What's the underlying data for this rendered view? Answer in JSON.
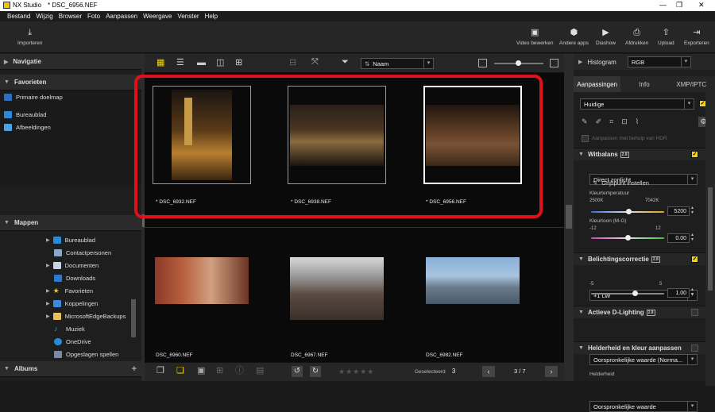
{
  "window": {
    "app_name": "NX Studio",
    "document": "* DSC_6956.NEF"
  },
  "menu": [
    "Bestand",
    "Wijzig",
    "Browser",
    "Foto",
    "Aanpassen",
    "Weergave",
    "Venster",
    "Help"
  ],
  "toolbar": {
    "import": "Importeren",
    "right_buttons": [
      "Video bewerken",
      "Andere apps",
      "Diashow",
      "Afdrukken",
      "Upload",
      "Exporteren"
    ]
  },
  "left": {
    "navigatie": "Navigatie",
    "favorieten": "Favorieten",
    "fav_items": [
      "Primaire doelmap",
      "Bureaublad",
      "Afbeeldingen"
    ],
    "mappen": "Mappen",
    "folders": [
      "Bureaublad",
      "Contactpersonen",
      "Documenten",
      "Downloads",
      "Favorieten",
      "Koppelingen",
      "MicrosoftEdgeBackups",
      "Muziek",
      "OneDrive",
      "Opgeslagen spellen"
    ],
    "albums": "Albums",
    "albums_add": "+"
  },
  "center": {
    "sort_label": "Naam",
    "row1": [
      {
        "name": "* DSC_6932.NEF"
      },
      {
        "name": "* DSC_6938.NEF"
      },
      {
        "name": "* DSC_6956.NEF"
      }
    ],
    "row2": [
      {
        "name": "DSC_6960.NEF"
      },
      {
        "name": "DSC_6967.NEF"
      },
      {
        "name": "DSC_6982.NEF"
      }
    ],
    "selected_label": "Geselecteerd",
    "selected_count": "3",
    "page": "3 / 7"
  },
  "right": {
    "histogram": "Histogram",
    "hist_mode": "RGB",
    "tabs": [
      "Aanpassingen",
      "Info",
      "XMP/IPTC"
    ],
    "preset": "Huidige",
    "hdr_note": "Aanpassen met behulp van HDR",
    "wb": {
      "title": "Witbalans",
      "value": "Direct zonlicht",
      "grey": "Grijspunt instellen",
      "temp_label": "Kleurtemperatuur",
      "temp_min": "2500K",
      "temp_max": "7042K",
      "temp_val": "5200",
      "tint_label": "Kleurtoon (M-G)",
      "tint_min": "-12",
      "tint_max": "12",
      "tint_val": "0.00",
      "temp_level": 0.52,
      "tint_level": 0.5
    },
    "exp": {
      "title": "Belichtingscorrectie",
      "value": "+1 LW",
      "min": "-5",
      "max": "5",
      "val": "1.00",
      "level": 0.6
    },
    "adl": {
      "title": "Actieve D-Lighting",
      "value": "Oorspronkelijke waarde (Norma..."
    },
    "hk": {
      "title": "Helderheid en kleur aanpassen",
      "value": "Oorspronkelijke waarde",
      "sub": "Helderheid"
    },
    "badge": "2.8"
  },
  "colors": {
    "selection": "#e0101a",
    "checkbox": "#f5d800",
    "accent": "#f5c400"
  }
}
